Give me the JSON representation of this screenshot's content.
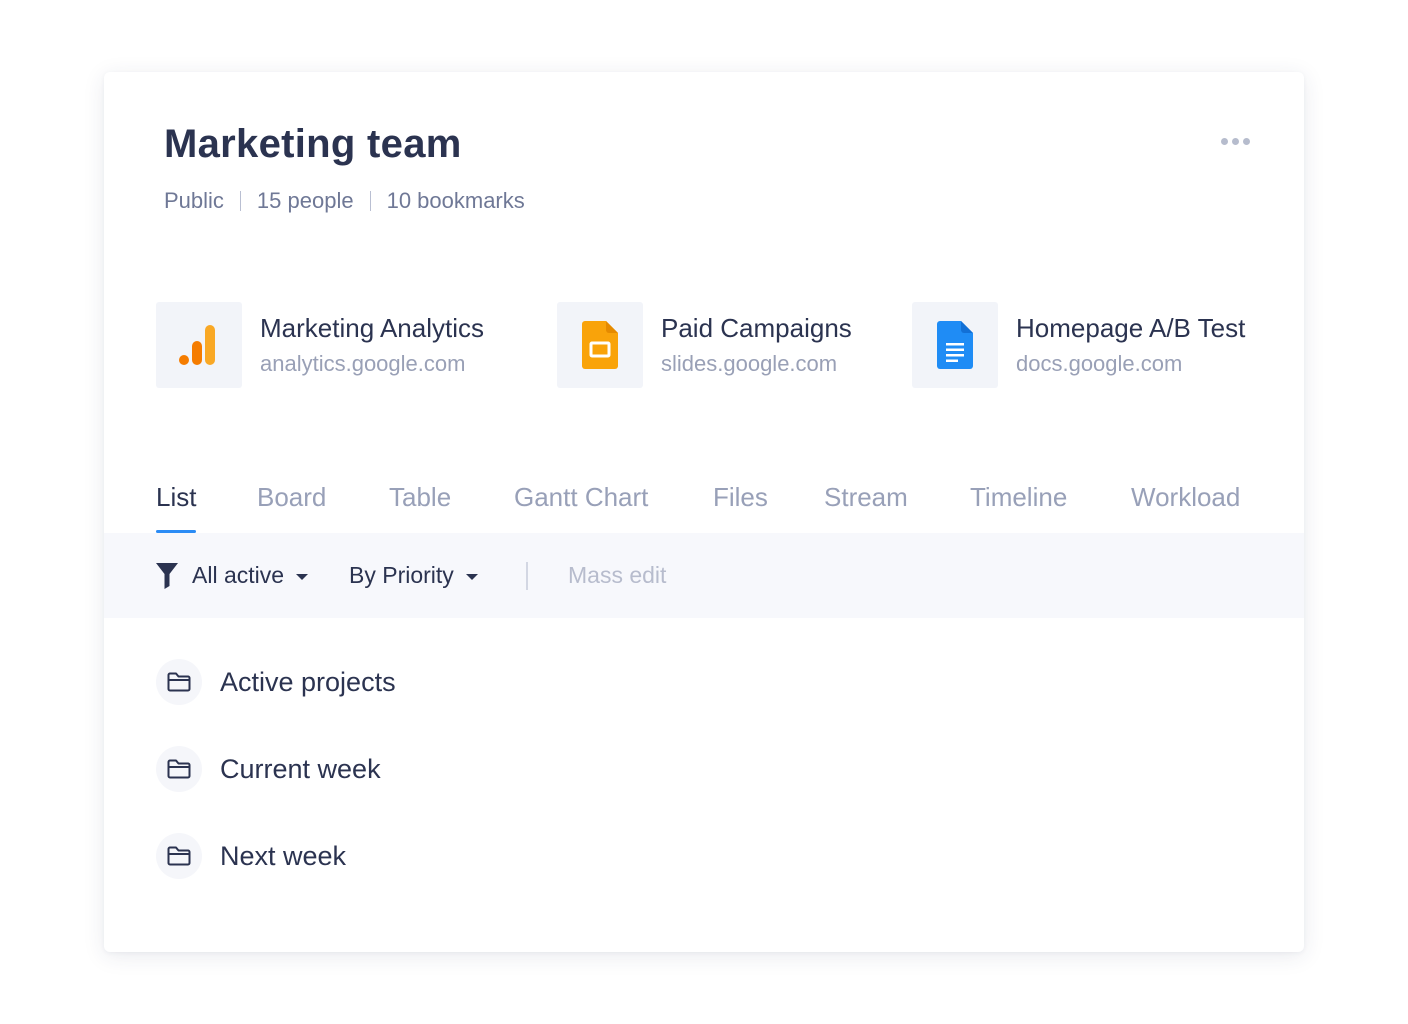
{
  "header": {
    "title": "Marketing team",
    "meta": [
      "Public",
      "15 people",
      "10 bookmarks"
    ]
  },
  "bookmarks": [
    {
      "name": "Marketing Analytics",
      "url": "analytics.google.com",
      "icon": "google-analytics-icon",
      "color": "#f9a825"
    },
    {
      "name": "Paid Campaigns",
      "url": "slides.google.com",
      "icon": "google-slides-icon",
      "color": "#f9a30a"
    },
    {
      "name": "Homepage A/B Test",
      "url": "docs.google.com",
      "icon": "google-docs-icon",
      "color": "#1f8cf5"
    }
  ],
  "tabs": [
    {
      "label": "List",
      "active": true
    },
    {
      "label": "Board"
    },
    {
      "label": "Table"
    },
    {
      "label": "Gantt Chart"
    },
    {
      "label": "Files"
    },
    {
      "label": "Stream"
    },
    {
      "label": "Timeline"
    },
    {
      "label": "Workload"
    }
  ],
  "toolbar": {
    "filter_label": "All active",
    "sort_label": "By Priority",
    "mass_edit_label": "Mass edit"
  },
  "folders": [
    {
      "label": "Active projects",
      "icon": "folder-icon"
    },
    {
      "label": "Current week",
      "icon": "folder-icon"
    },
    {
      "label": "Next week",
      "icon": "folder-icon"
    }
  ],
  "colors": {
    "accent": "#2b8cf5",
    "text_primary": "#2b3350",
    "text_muted": "#98a0b8"
  }
}
